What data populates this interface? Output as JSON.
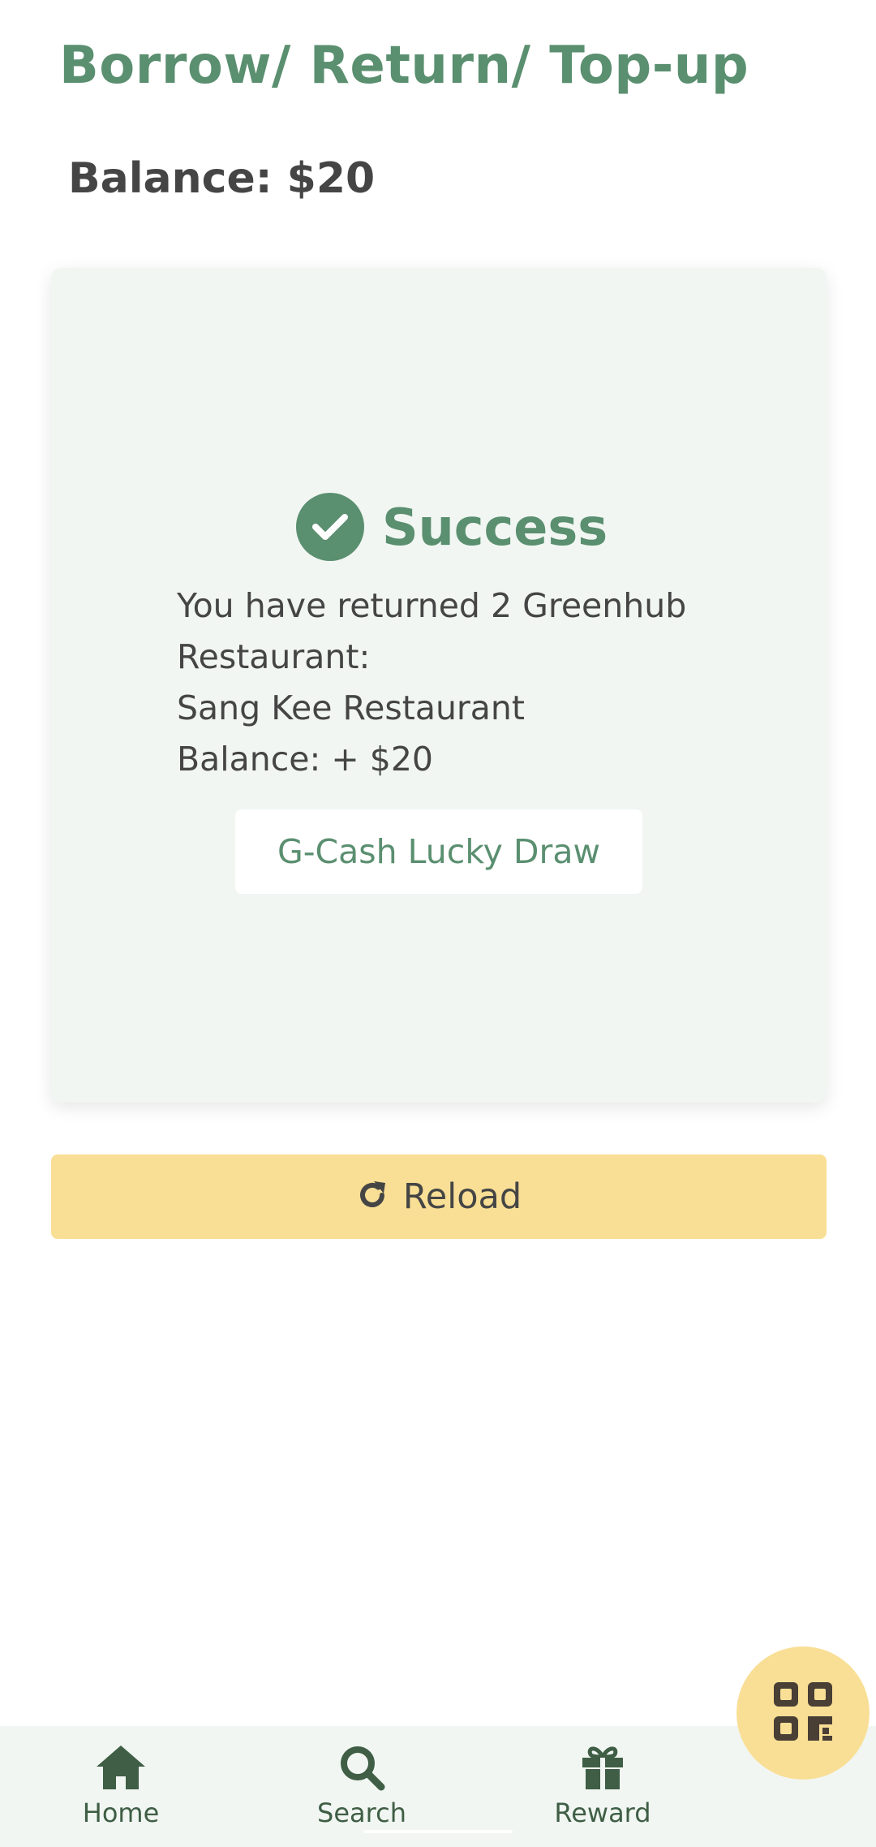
{
  "header": {
    "title": "Borrow/ Return/ Top-up",
    "balance": "Balance: $20"
  },
  "result_card": {
    "status": "Success",
    "status_icon": "check-circle-icon",
    "message_lines": [
      "You have returned 2 Greenhub",
      "Restaurant:",
      "Sang Kee Restaurant",
      "Balance: + $20"
    ],
    "lucky_draw_label": "G-Cash Lucky Draw"
  },
  "reload": {
    "label": "Reload",
    "icon": "rotate-right-icon"
  },
  "bottom_nav": {
    "items": [
      {
        "label": "Home",
        "icon": "home-icon"
      },
      {
        "label": "Search",
        "icon": "search-icon"
      },
      {
        "label": "Reward",
        "icon": "gift-icon"
      }
    ]
  },
  "fab": {
    "icon": "qr-code-icon"
  },
  "colors": {
    "primary_green": "#5a8f70",
    "card_bg": "#f1f6f2",
    "accent_yellow": "#f9df95",
    "text_dark": "#454545",
    "nav_dark": "#3f5e45"
  }
}
